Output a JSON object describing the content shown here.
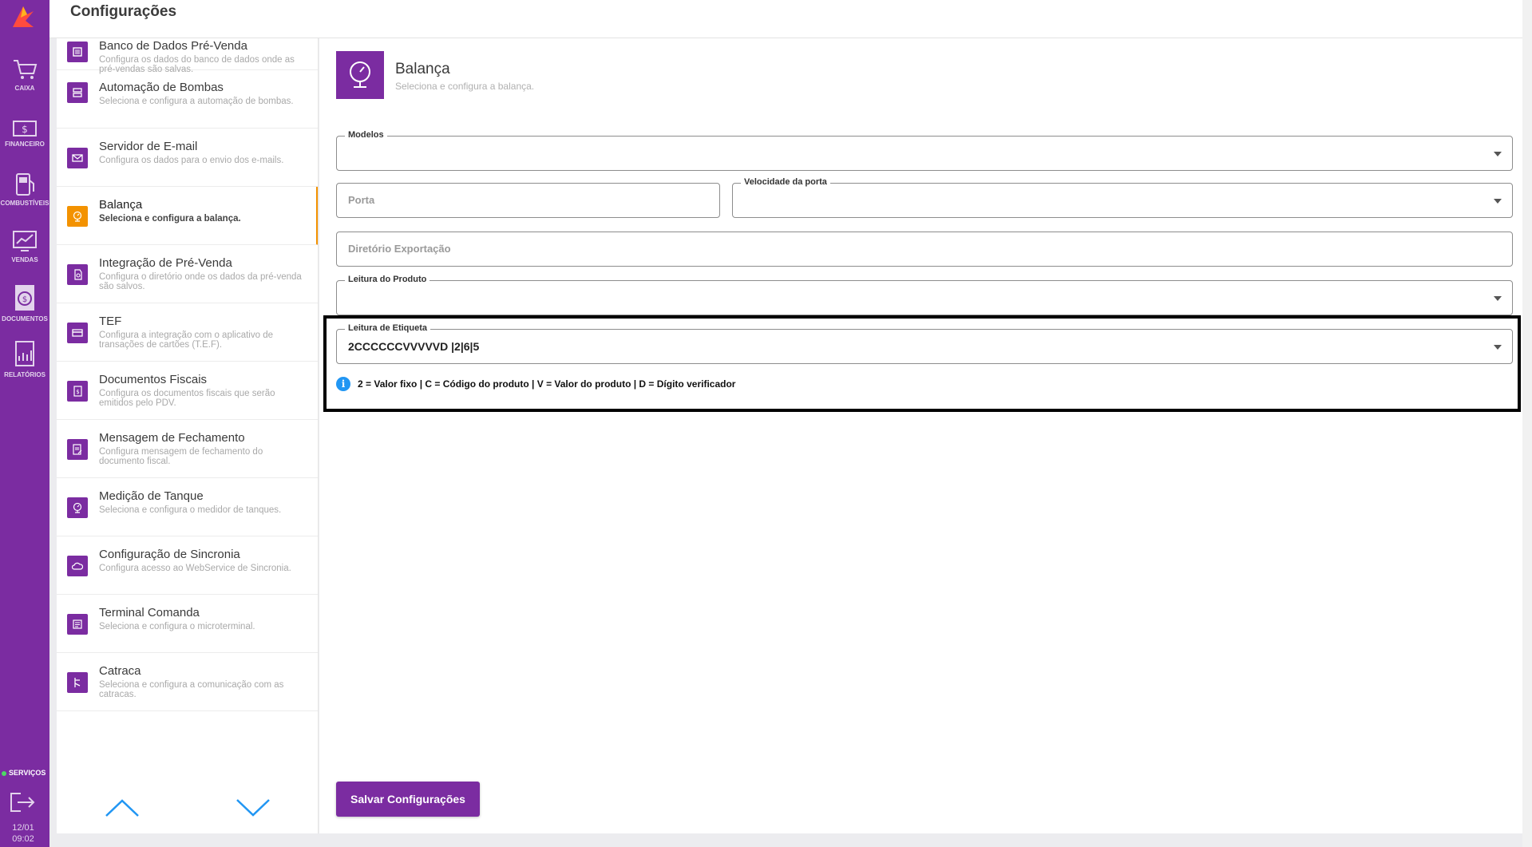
{
  "header": {
    "title": "Configurações"
  },
  "rail": {
    "items": [
      {
        "label": "CAIXA",
        "icon": "cart-icon"
      },
      {
        "label": "FINANCEIRO",
        "icon": "money-icon"
      },
      {
        "label": "COMBUSTÍVEIS",
        "icon": "fuel-pump-icon"
      },
      {
        "label": "VENDAS",
        "icon": "sales-chart-icon"
      },
      {
        "label": "DOCUMENTOS",
        "icon": "document-money-icon"
      },
      {
        "label": "RELATÓRIOS",
        "icon": "report-icon"
      }
    ],
    "services_label": "SERVIÇOS",
    "date": "12/01",
    "time": "09:02"
  },
  "settings_list": {
    "items": [
      {
        "title": "Banco de Dados Pré-Venda",
        "desc": "Configura os dados do banco de dados onde as pré-vendas são salvas."
      },
      {
        "title": "Automação de Bombas",
        "desc": "Seleciona e configura a automação de bombas."
      },
      {
        "title": "Servidor de E-mail",
        "desc": "Configura os dados para o envio dos e-mails."
      },
      {
        "title": "Balança",
        "desc": "Seleciona e configura a balança."
      },
      {
        "title": "Integração de Pré-Venda",
        "desc": "Configura o diretório onde os dados da pré-venda são salvos."
      },
      {
        "title": "TEF",
        "desc": "Configura a integração com o aplicativo de transações de cartões (T.E.F)."
      },
      {
        "title": "Documentos Fiscais",
        "desc": "Configura os documentos fiscais que serão emitidos pelo PDV."
      },
      {
        "title": "Mensagem de Fechamento",
        "desc": "Configura mensagem de fechamento do documento fiscal."
      },
      {
        "title": "Medição de Tanque",
        "desc": "Seleciona e configura o medidor de tanques."
      },
      {
        "title": "Configuração de Sincronia",
        "desc": "Configura acesso ao WebService de Sincronia."
      },
      {
        "title": "Terminal Comanda",
        "desc": "Seleciona e configura o microterminal."
      },
      {
        "title": "Catraca",
        "desc": "Seleciona e configura a comunicação com as catracas."
      }
    ]
  },
  "section": {
    "title": "Balança",
    "desc": "Seleciona e configura a balança."
  },
  "form": {
    "modelos_label": "Modelos",
    "porta_placeholder": "Porta",
    "velocidade_label": "Velocidade da porta",
    "diretorio_placeholder": "Diretório Exportação",
    "leitura_produto_label": "Leitura do Produto",
    "leitura_etiqueta_label": "Leitura de Etiqueta",
    "leitura_etiqueta_value": "2CCCCCCVVVVVD |2|6|5",
    "hint": "2 = Valor fixo | C = Código do produto | V = Valor do produto | D = Dígito verificador",
    "info_glyph": "i"
  },
  "actions": {
    "save_label": "Salvar Configurações"
  },
  "colors": {
    "primary": "#7b2ca1",
    "active": "#f39200",
    "info": "#2196f3"
  }
}
